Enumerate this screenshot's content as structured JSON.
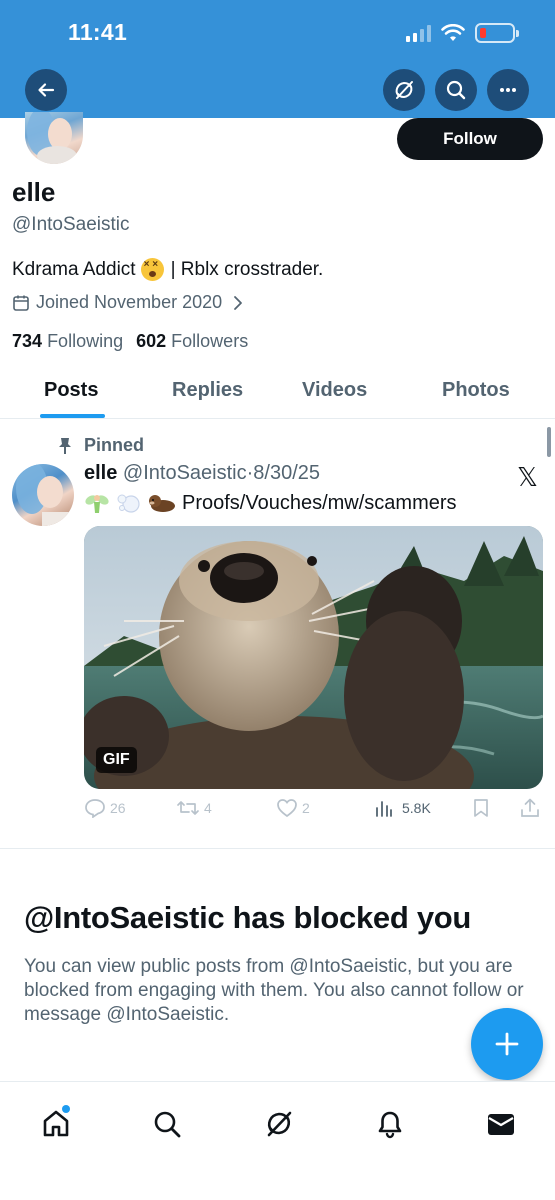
{
  "status_bar": {
    "time": "11:41"
  },
  "profile": {
    "follow_label": "Follow",
    "name": "elle",
    "handle": "@IntoSaeistic",
    "bio_before_emoji": "Kdrama Addict",
    "bio_after_emoji": "| Rblx crosstrader.",
    "joined": "Joined November 2020",
    "following_count": "734",
    "following_label": "Following",
    "followers_count": "602",
    "followers_label": "Followers"
  },
  "tabs": [
    {
      "label": "Posts",
      "active": true
    },
    {
      "label": "Replies",
      "active": false
    },
    {
      "label": "Videos",
      "active": false
    },
    {
      "label": "Photos",
      "active": false
    }
  ],
  "post": {
    "pinned_label": "Pinned",
    "author_name": "elle",
    "author_handle": "@IntoSaeistic",
    "separator": "·",
    "date": "8/30/25",
    "text": "Proofs/Vouches/mw/scammers",
    "media_badge": "GIF",
    "replies": "26",
    "reposts": "4",
    "likes": "2",
    "views": "5.8K"
  },
  "blocked": {
    "title": "@IntoSaeistic has blocked you",
    "body": "You can view public posts from @IntoSaeistic, but you are blocked from engaging with them. You also cannot follow or message @IntoSaeistic."
  },
  "icons": {
    "header": [
      "back-arrow-icon",
      "grok-icon",
      "search-icon",
      "more-icon"
    ],
    "bottom_nav": [
      "home-icon",
      "search-icon",
      "grok-icon",
      "bell-icon",
      "mail-icon"
    ]
  },
  "colors": {
    "header_bg": "#3591d8",
    "accent": "#1d9bf0",
    "text_primary": "#0f1419",
    "text_secondary": "#536471"
  }
}
